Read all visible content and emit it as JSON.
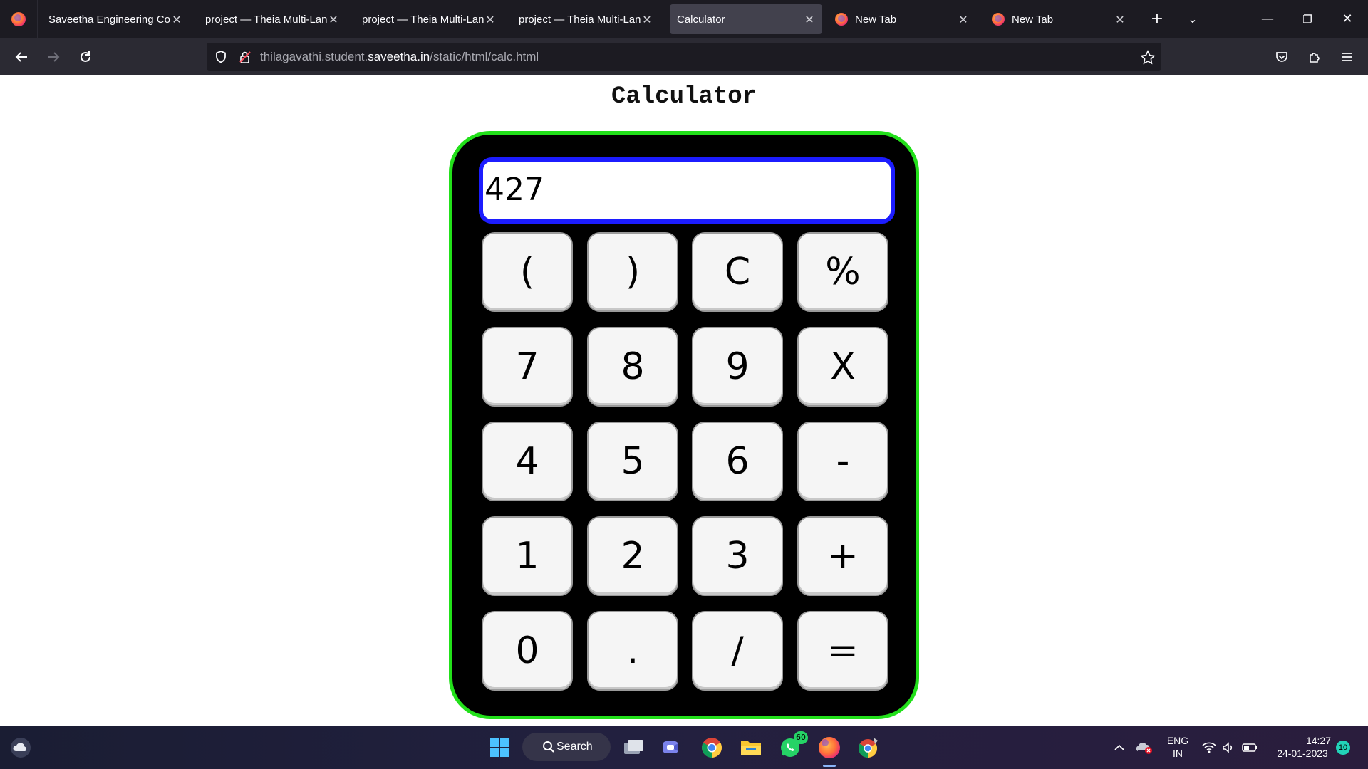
{
  "browser": {
    "tabs": [
      {
        "title": "Saveetha Engineering Colle",
        "active": false,
        "favicon": "none"
      },
      {
        "title": "project — Theia Multi-Lang",
        "active": false,
        "favicon": "none"
      },
      {
        "title": "project — Theia Multi-Lang",
        "active": false,
        "favicon": "none"
      },
      {
        "title": "project — Theia Multi-Lang",
        "active": false,
        "favicon": "none"
      },
      {
        "title": "Calculator",
        "active": true,
        "favicon": "none"
      },
      {
        "title": "New Tab",
        "active": false,
        "favicon": "firefox"
      },
      {
        "title": "New Tab",
        "active": false,
        "favicon": "firefox"
      }
    ],
    "url": {
      "prefix": "thilagavathi.student.",
      "domain": "saveetha.in",
      "path": "/static/html/calc.html"
    }
  },
  "page": {
    "title": "Calculator",
    "display_value": "427",
    "keys": [
      [
        "(",
        ")",
        "C",
        "%"
      ],
      [
        "7",
        "8",
        "9",
        "X"
      ],
      [
        "4",
        "5",
        "6",
        "-"
      ],
      [
        "1",
        "2",
        "3",
        "+"
      ],
      [
        "0",
        ".",
        "/",
        "="
      ]
    ],
    "colors": {
      "calculator_body": "#000000",
      "calculator_border": "#22e01a",
      "display_border": "#1c1cff",
      "key_background": "#f5f5f5"
    }
  },
  "taskbar": {
    "search_label": "Search",
    "whatsapp_badge": "60",
    "language_line1": "ENG",
    "language_line2": "IN",
    "time": "14:27",
    "date": "24-01-2023",
    "notification_count": "10"
  }
}
